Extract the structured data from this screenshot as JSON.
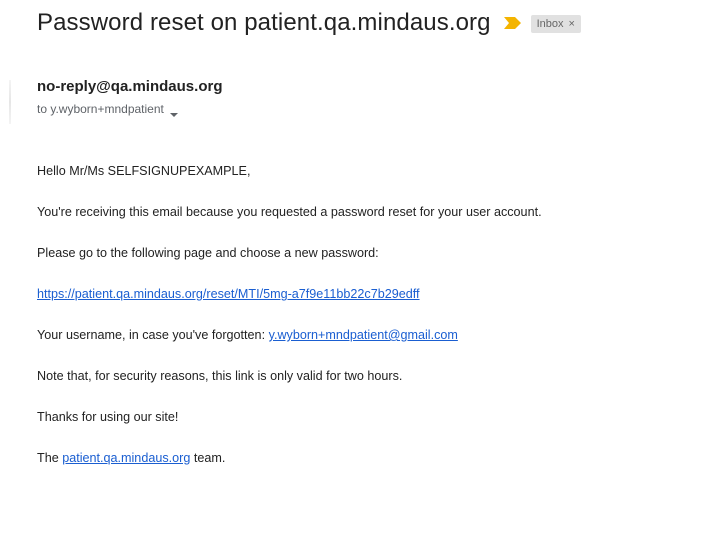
{
  "email": {
    "subject": "Password reset on patient.qa.mindaus.org",
    "label": "Inbox",
    "label_close": "×",
    "sender": "no-reply@qa.mindaus.org",
    "recipient": "to y.wyborn+mndpatient",
    "body": {
      "greeting": "Hello Mr/Ms SELFSIGNUPEXAMPLE,",
      "reason": "You're receiving this email because you requested a password reset for your user account.",
      "instruction": "Please go to the following page and choose a new password:",
      "reset_link": "https://patient.qa.mindaus.org/reset/MTI/5mg-a7f9e11bb22c7b29edff",
      "username_prefix": "Your username, in case you've forgotten: ",
      "username": "y.wyborn+mndpatient@gmail.com",
      "security_note": "Note that, for security reasons, this link is only valid for two hours.",
      "thanks": "Thanks for using our site!",
      "signoff_prefix": "The ",
      "signoff_link": "patient.qa.mindaus.org",
      "signoff_suffix": " team."
    }
  },
  "colors": {
    "importance": "#f4b400",
    "link": "#1a5ed1",
    "chip_bg": "#e1e1e1"
  },
  "icons": {
    "importance": "importance-marker-icon",
    "recipient_toggle": "chevron-down-icon"
  }
}
